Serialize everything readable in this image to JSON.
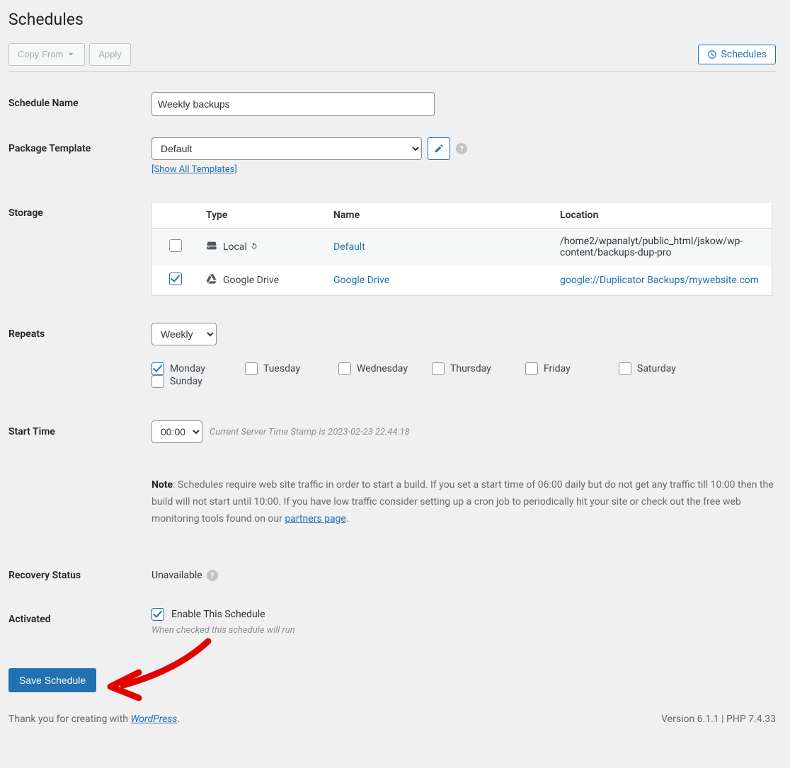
{
  "page_title": "Schedules",
  "toolbar": {
    "copy_from": "Copy From",
    "apply": "Apply",
    "schedules_btn": "Schedules"
  },
  "labels": {
    "schedule_name": "Schedule Name",
    "package_template": "Package Template",
    "storage": "Storage",
    "repeats": "Repeats",
    "start_time": "Start Time",
    "recovery_status": "Recovery Status",
    "activated": "Activated"
  },
  "schedule_name_value": "Weekly backups",
  "package_template": {
    "value": "Default",
    "show_all": "[Show All Templates]"
  },
  "storage": {
    "headers": {
      "type": "Type",
      "name": "Name",
      "location": "Location"
    },
    "rows": [
      {
        "checked": false,
        "type_label": "Local",
        "type_icon": "hdd-icon",
        "has_refresh": true,
        "name": "Default",
        "name_url": false,
        "location": "/home2/wpanalyt/public_html/jskow/wp-content/backups-dup-pro",
        "location_link": false
      },
      {
        "checked": true,
        "type_label": "Google Drive",
        "type_icon": "gdrive-icon",
        "has_refresh": false,
        "name": "Google Drive",
        "name_url": true,
        "location": "google://Duplicator Backups/mywebsite.com",
        "location_link": true
      }
    ]
  },
  "repeats": {
    "value": "Weekly",
    "days": [
      {
        "label": "Monday",
        "checked": true
      },
      {
        "label": "Tuesday",
        "checked": false
      },
      {
        "label": "Wednesday",
        "checked": false
      },
      {
        "label": "Thursday",
        "checked": false
      },
      {
        "label": "Friday",
        "checked": false
      },
      {
        "label": "Saturday",
        "checked": false
      },
      {
        "label": "Sunday",
        "checked": false
      }
    ]
  },
  "start_time": {
    "value": "00:00",
    "hint_prefix": "Current Server Time Stamp is ",
    "hint_stamp": "2023-02-23 22:44:18"
  },
  "note": {
    "bold": "Note",
    "text1": ": Schedules require web site traffic in order to start a build. If you set a start time of 06:00 daily but do not get any traffic till 10:00 then the build will not start until 10:00. If you have low traffic consider setting up a cron job to periodically hit your site or check out the free web monitoring tools found on our ",
    "link": "partners page",
    "text2": "."
  },
  "recovery_status": "Unavailable",
  "activated": {
    "checked": true,
    "label": "Enable This Schedule",
    "help": "When checked this schedule will run"
  },
  "save_btn": "Save Schedule",
  "footer": {
    "thanks_prefix": "Thank you for creating with ",
    "thanks_link": "WordPress",
    "thanks_suffix": ".",
    "version": "Version 6.1.1 | PHP 7.4.33"
  }
}
